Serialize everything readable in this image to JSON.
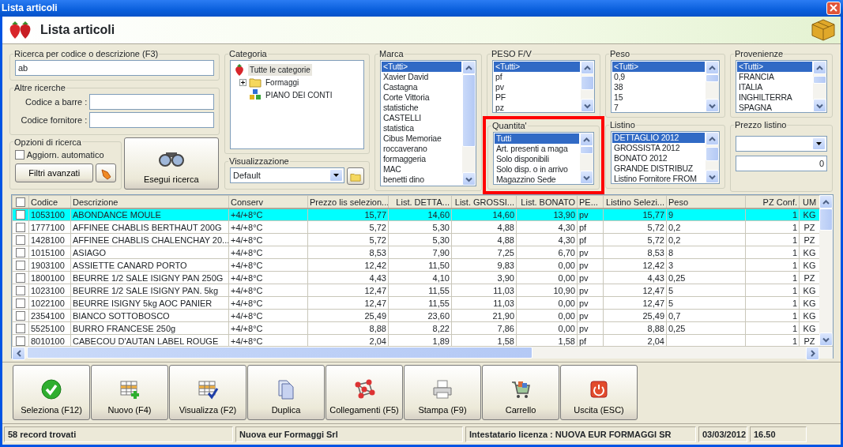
{
  "window": {
    "title": "Lista articoli"
  },
  "header": {
    "title": "Lista articoli"
  },
  "search": {
    "label": "Ricerca per codice o descrizione (F3)",
    "value": "ab"
  },
  "other_searches": {
    "label": "Altre ricerche",
    "fields": [
      {
        "label": "Codice a barre :"
      },
      {
        "label": "Codice fornitore :"
      }
    ]
  },
  "options": {
    "label": "Opzioni di ricerca",
    "auto_update": {
      "label": "Aggiorn. automatico",
      "checked": false
    },
    "advanced_button": "Filtri avanzati"
  },
  "search_button": "Esegui ricerca",
  "category": {
    "label": "Categoria",
    "tree": [
      {
        "label": "Tutte le categorie",
        "kind": "strawberry",
        "selected": true,
        "children": [
          {
            "label": "Formaggi",
            "kind": "folder",
            "selected": false,
            "expanded": false
          },
          {
            "label": "PIANO DEI CONTI",
            "kind": "blocks",
            "selected": false
          }
        ]
      }
    ]
  },
  "view": {
    "label": "Visualizzazione",
    "value": "Default"
  },
  "marca": {
    "label": "Marca",
    "items": [
      {
        "text": "<Tutti>",
        "selected": true
      },
      {
        "text": "Xavier David",
        "selected": false
      },
      {
        "text": "Castagna",
        "selected": false
      },
      {
        "text": "Corte Vittoria",
        "selected": false
      },
      {
        "text": "statistiche",
        "selected": false
      },
      {
        "text": "CASTELLI",
        "selected": false
      },
      {
        "text": "statistica",
        "selected": false
      },
      {
        "text": "Cibus Memoriae",
        "selected": false
      },
      {
        "text": "roccaverano",
        "selected": false
      },
      {
        "text": "formaggeria",
        "selected": false
      },
      {
        "text": "MAC",
        "selected": false
      },
      {
        "text": "benetti dino",
        "selected": false
      }
    ]
  },
  "peso_fv": {
    "label": "PESO F/V",
    "items": [
      {
        "text": "<Tutti>",
        "selected": true
      },
      {
        "text": "pf",
        "selected": false
      },
      {
        "text": "pv",
        "selected": false
      },
      {
        "text": "PF",
        "selected": false
      },
      {
        "text": "pz",
        "selected": false
      }
    ]
  },
  "peso": {
    "label": "Peso",
    "items": [
      {
        "text": "<Tutti>",
        "selected": true
      },
      {
        "text": "0,9",
        "selected": false
      },
      {
        "text": "38",
        "selected": false
      },
      {
        "text": "15",
        "selected": false
      },
      {
        "text": "7",
        "selected": false
      }
    ]
  },
  "provenienze": {
    "label": "Provenienze",
    "items": [
      {
        "text": "<Tutti>",
        "selected": true
      },
      {
        "text": "FRANCIA",
        "selected": false
      },
      {
        "text": "ITALIA",
        "selected": false
      },
      {
        "text": "INGHILTERRA",
        "selected": false
      },
      {
        "text": "SPAGNA",
        "selected": false
      }
    ]
  },
  "quantita": {
    "label": "Quantita'",
    "highlighted": true,
    "items": [
      {
        "text": "Tutti",
        "selected": true
      },
      {
        "text": "Art. presenti a maga",
        "selected": false
      },
      {
        "text": "Solo disponibili",
        "selected": false
      },
      {
        "text": "Solo disp. o in arrivo",
        "selected": false
      },
      {
        "text": "Magazzino Sede",
        "selected": false
      }
    ]
  },
  "listino": {
    "label": "Listino",
    "items": [
      {
        "text": "DETTAGLIO 2012",
        "selected": true
      },
      {
        "text": "GROSSISTA 2012",
        "selected": false
      },
      {
        "text": "BONATO 2012",
        "selected": false
      },
      {
        "text": "GRANDE DISTRIBUZ",
        "selected": false
      },
      {
        "text": "Listino Fornitore FROM",
        "selected": false
      }
    ]
  },
  "prezzo_listino": {
    "label": "Prezzo listino",
    "amount": "0"
  },
  "table": {
    "all_checked": false,
    "columns": [
      {
        "label": "Codice"
      },
      {
        "label": "Descrizione"
      },
      {
        "label": "Conserv"
      },
      {
        "label": "Prezzo lis selezion..."
      },
      {
        "label": "List. DETTA..."
      },
      {
        "label": "List. GROSSI..."
      },
      {
        "label": "List. BONATO"
      },
      {
        "label": "PE..."
      },
      {
        "label": "Listino Selezi..."
      },
      {
        "label": "Peso"
      },
      {
        "label": "PZ Conf."
      },
      {
        "label": "UM"
      }
    ],
    "rows": [
      {
        "selected": true,
        "checked": false,
        "cells": [
          "1053100",
          "ABONDANCE MOULE",
          "+4/+8°C",
          "15,77",
          "14,60",
          "14,60",
          "13,90",
          "pv",
          "15,77",
          "9",
          "1",
          "KG"
        ]
      },
      {
        "selected": false,
        "checked": false,
        "cells": [
          "1777100",
          "AFFINEE CHABLIS BERTHAUT 200G",
          "+4/+8°C",
          "5,72",
          "5,30",
          "4,88",
          "4,30",
          "pf",
          "5,72",
          "0,2",
          "1",
          "PZ"
        ]
      },
      {
        "selected": false,
        "checked": false,
        "cells": [
          "1428100",
          "AFFINEE CHABLIS CHALENCHAY 20...",
          "+4/+8°C",
          "5,72",
          "5,30",
          "4,88",
          "4,30",
          "pf",
          "5,72",
          "0,2",
          "1",
          "PZ"
        ]
      },
      {
        "selected": false,
        "checked": false,
        "cells": [
          "1015100",
          "ASIAGO",
          "+4/+8°C",
          "8,53",
          "7,90",
          "7,25",
          "6,70",
          "pv",
          "8,53",
          "8",
          "1",
          "KG"
        ]
      },
      {
        "selected": false,
        "checked": false,
        "cells": [
          "1903100",
          "ASSIETTE CANARD PORTO",
          "+4/+8°C",
          "12,42",
          "11,50",
          "9,83",
          "0,00",
          "pv",
          "12,42",
          "3",
          "1",
          "KG"
        ]
      },
      {
        "selected": false,
        "checked": false,
        "cells": [
          "1800100",
          "BEURRE 1/2 SALE  ISIGNY PAN  250G",
          "+4/+8°C",
          "4,43",
          "4,10",
          "3,90",
          "0,00",
          "pv",
          "4,43",
          "0,25",
          "1",
          "PZ"
        ]
      },
      {
        "selected": false,
        "checked": false,
        "cells": [
          "1023100",
          "BEURRE 1/2 SALE  ISIGNY PAN. 5kg",
          "+4/+8°C",
          "12,47",
          "11,55",
          "11,03",
          "10,90",
          "pv",
          "12,47",
          "5",
          "1",
          "KG"
        ]
      },
      {
        "selected": false,
        "checked": false,
        "cells": [
          "1022100",
          "BEURRE ISIGNY  5kg AOC PANIER",
          "+4/+8°C",
          "12,47",
          "11,55",
          "11,03",
          "0,00",
          "pv",
          "12,47",
          "5",
          "1",
          "KG"
        ]
      },
      {
        "selected": false,
        "checked": false,
        "cells": [
          "2354100",
          "BIANCO SOTTOBOSCO",
          "+4/+8°C",
          "25,49",
          "23,60",
          "21,90",
          "0,00",
          "pv",
          "25,49",
          "0,7",
          "1",
          "KG"
        ]
      },
      {
        "selected": false,
        "checked": false,
        "cells": [
          "5525100",
          "BURRO FRANCESE 250g",
          "+4/+8°C",
          "8,88",
          "8,22",
          "7,86",
          "0,00",
          "pv",
          "8,88",
          "0,25",
          "1",
          "KG"
        ]
      },
      {
        "selected": false,
        "checked": false,
        "cells": [
          "8010100",
          "CABECOU D'AUTAN LABEL ROUGE",
          "+4/+8°C",
          "2,04",
          "1,89",
          "1,58",
          "1,58",
          "pf",
          "2,04",
          "",
          "1",
          "PZ"
        ]
      }
    ]
  },
  "toolbar": [
    {
      "label": "Seleziona (F12)",
      "kind": "check"
    },
    {
      "label": "Nuovo (F4)",
      "kind": "grid-add"
    },
    {
      "label": "Visualizza (F2)",
      "kind": "grid-check"
    },
    {
      "label": "Duplica",
      "kind": "documents"
    },
    {
      "label": "Collegamenti (F5)",
      "kind": "network"
    },
    {
      "label": "Stampa (F9)",
      "kind": "printer"
    },
    {
      "label": "Carrello",
      "kind": "cart"
    },
    {
      "label": "Uscita (ESC)",
      "kind": "power"
    }
  ],
  "status_bar": [
    "58 record trovati",
    "Nuova eur Formaggi Srl",
    "Intestatario licenza : NUOVA EUR FORMAGGI SR",
    "03/03/2012",
    "16.50"
  ]
}
